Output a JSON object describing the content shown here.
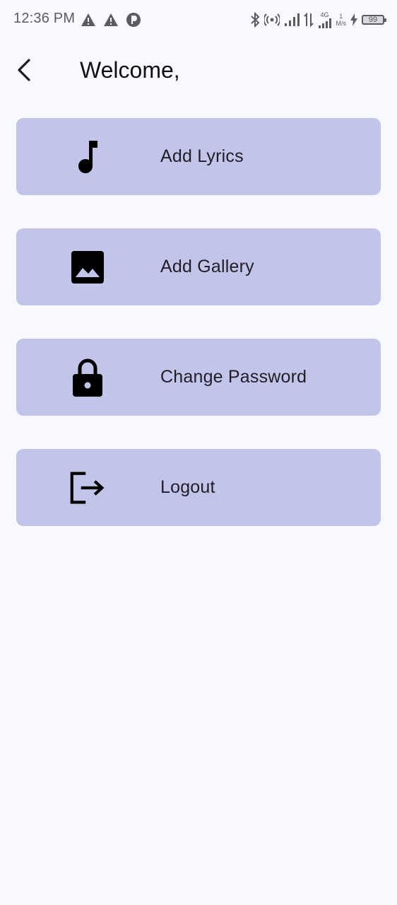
{
  "status_bar": {
    "time": "12:36 PM",
    "network_speed_value": "1",
    "network_speed_unit": "M/s",
    "network_type": "4G",
    "battery_level": "99"
  },
  "header": {
    "title": "Welcome,"
  },
  "menu": {
    "items": [
      {
        "label": "Add Lyrics",
        "icon": "music-note-icon"
      },
      {
        "label": "Add Gallery",
        "icon": "image-icon"
      },
      {
        "label": "Change Password",
        "icon": "lock-icon"
      },
      {
        "label": "Logout",
        "icon": "logout-icon"
      }
    ]
  },
  "colors": {
    "background": "#f8f8ff",
    "card": "#c3c4ea",
    "text": "#1c1b22"
  }
}
